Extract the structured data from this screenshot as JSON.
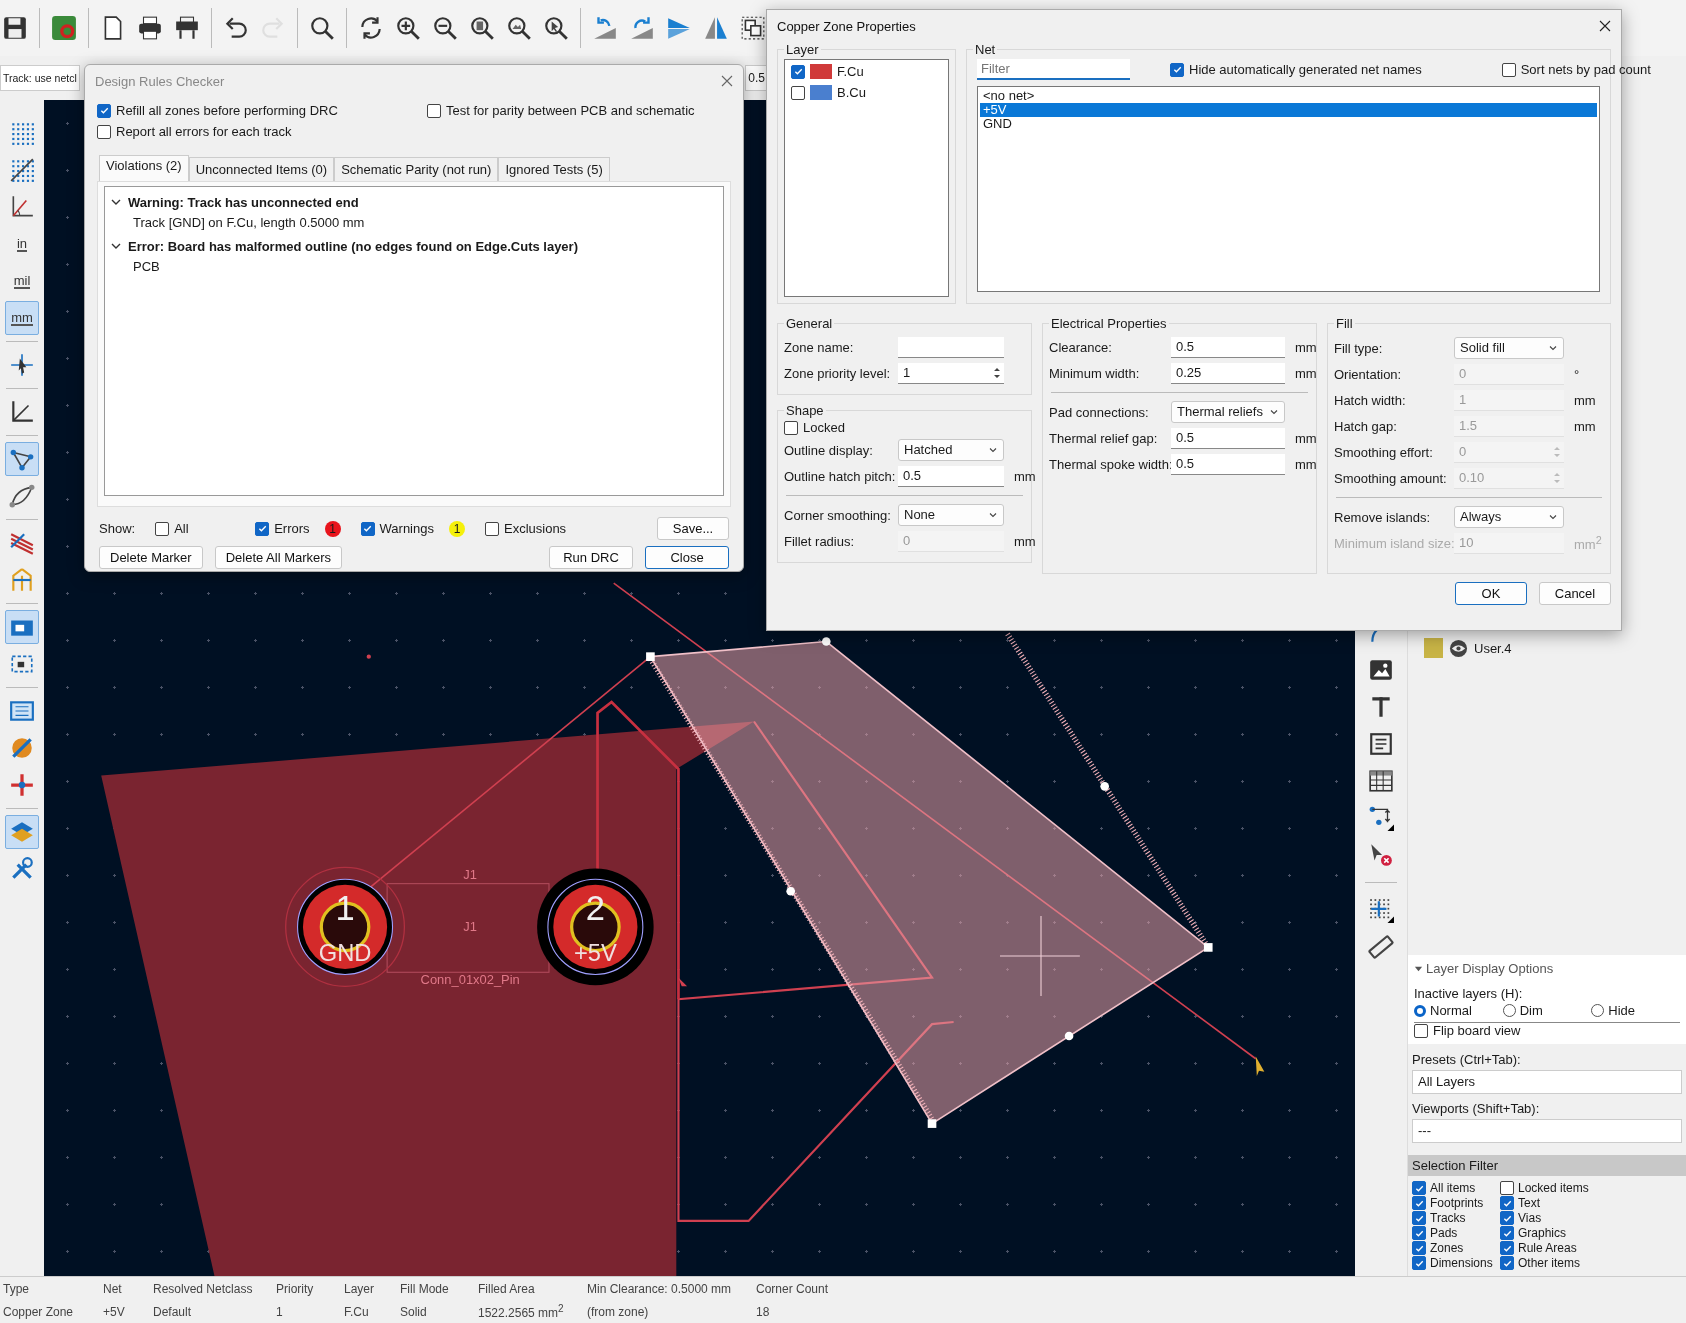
{
  "top_toolbar": [
    {
      "disabled": false
    },
    {
      "disabled": false
    },
    {
      "disabled": false
    },
    {
      "disabled": false
    },
    {
      "disabled": false
    },
    {
      "disabled": false
    },
    {
      "disabled": true
    },
    {
      "disabled": false
    },
    {
      "disabled": false
    },
    {
      "disabled": false
    },
    {
      "disabled": false
    },
    {
      "disabled": false
    },
    {
      "disabled": false
    },
    {
      "disabled": false
    },
    {
      "disabled": false
    },
    {
      "disabled": false
    },
    {
      "disabled": false
    },
    {
      "disabled": false
    },
    {
      "disabled": false
    }
  ],
  "aux_toolbar": {
    "track_selector": "Track: use netcl",
    "width_field": "0.5"
  },
  "left_toolbar": [
    {
      "selected": false
    },
    {
      "selected": false
    },
    {
      "selected": false
    },
    {
      "label": "in",
      "selected": false
    },
    {
      "label": "mil",
      "selected": false
    },
    {
      "label": "mm",
      "selected": true
    },
    {
      "selected": false
    },
    {
      "selected": false
    },
    {
      "selected": true
    },
    {
      "selected": false
    },
    {
      "selected": false
    },
    {
      "selected": false
    },
    {
      "selected": true
    },
    {
      "selected": false
    },
    {
      "selected": false
    },
    {
      "selected": false
    },
    {
      "selected": false
    },
    {
      "selected": true
    },
    {
      "selected": false
    }
  ],
  "pcb": {
    "pads": [
      {
        "number": "1",
        "net": "GND"
      },
      {
        "number": "2",
        "net": "+5V"
      }
    ],
    "reference_labels": [
      "J1",
      "J1"
    ],
    "value_label": "Conn_01x02_Pin"
  },
  "layers_panel": {
    "layers": [
      {
        "name": "User.4",
        "color": "#c8b446",
        "visible": true
      }
    ],
    "display_options": {
      "title": "Layer Display Options",
      "expanded": true,
      "inactive_label": "Inactive layers (H):",
      "radios": [
        {
          "label": "Normal",
          "selected": true
        },
        {
          "label": "Dim",
          "selected": false
        },
        {
          "label": "Hide",
          "selected": false
        }
      ],
      "flip": {
        "label": "Flip board view",
        "checked": false
      }
    },
    "presets_label": "Presets (Ctrl+Tab):",
    "presets_value": "All Layers",
    "viewports_label": "Viewports (Shift+Tab):",
    "viewports_value": "---"
  },
  "selection_filter": {
    "title": "Selection Filter",
    "items": [
      {
        "label": "All items",
        "checked": true
      },
      {
        "label": "Locked items",
        "checked": false
      },
      {
        "label": "Footprints",
        "checked": true
      },
      {
        "label": "Text",
        "checked": true
      },
      {
        "label": "Tracks",
        "checked": true
      },
      {
        "label": "Vias",
        "checked": true
      },
      {
        "label": "Pads",
        "checked": true
      },
      {
        "label": "Graphics",
        "checked": true
      },
      {
        "label": "Zones",
        "checked": true
      },
      {
        "label": "Rule Areas",
        "checked": true
      },
      {
        "label": "Dimensions",
        "checked": true
      },
      {
        "label": "Other items",
        "checked": true
      }
    ]
  },
  "status_bar": [
    {
      "header": "Type",
      "value": "Copper Zone"
    },
    {
      "header": "Net",
      "value": "+5V"
    },
    {
      "header": "Resolved Netclass",
      "value": "Default"
    },
    {
      "header": "Priority",
      "value": "1"
    },
    {
      "header": "Layer",
      "value": "F.Cu"
    },
    {
      "header": "Fill Mode",
      "value": "Solid"
    },
    {
      "header": "Filled Area",
      "value": "1522.2565 mm$^{2}$"
    },
    {
      "header": "Min Clearance: 0.5000 mm",
      "value": "(from zone)"
    },
    {
      "header": "Corner Count",
      "value": "18"
    }
  ],
  "drc": {
    "title": "Design Rules Checker",
    "active": false,
    "options": [
      {
        "label": "Refill all zones before performing DRC",
        "checked": true
      },
      {
        "label": "Test for parity between PCB and schematic",
        "checked": false
      },
      {
        "label": "Report all errors for each track",
        "checked": false
      }
    ],
    "tabs": [
      {
        "label": "Violations (2)",
        "selected": true
      },
      {
        "label": "Unconnected Items (0)",
        "selected": false
      },
      {
        "label": "Schematic Parity (not run)",
        "selected": false
      },
      {
        "label": "Ignored Tests (5)",
        "selected": false
      }
    ],
    "violations": [
      {
        "title": "Warning: Track has unconnected end",
        "expanded": true,
        "children": [
          {
            "text": "Track [GND] on F.Cu, length 0.5000 mm"
          }
        ]
      },
      {
        "title": "Error: Board has malformed outline (no edges found on Edge.Cuts layer)",
        "expanded": true,
        "children": [
          {
            "text": "PCB"
          }
        ]
      }
    ],
    "show_label": "Show:",
    "filters": [
      {
        "label": "All",
        "checked": false
      },
      {
        "label": "Errors",
        "checked": true,
        "count": "1",
        "color": "#e8141c"
      },
      {
        "label": "Warnings",
        "checked": true,
        "count": "1",
        "color": "#f5f00a"
      },
      {
        "label": "Exclusions",
        "checked": false
      }
    ],
    "save_button": "Save...",
    "left_buttons": [
      "Delete Marker",
      "Delete All Markers"
    ],
    "right_buttons": [
      {
        "label": "Run DRC",
        "default": false
      },
      {
        "label": "Close",
        "default": true
      }
    ]
  },
  "zone": {
    "title": "Copper Zone Properties",
    "active": true,
    "layer_label": "Layer",
    "layers": [
      {
        "name": "F.Cu",
        "checked": true,
        "color": "#d03a3a"
      },
      {
        "name": "B.Cu",
        "checked": false,
        "color": "#4a7fcf"
      }
    ],
    "net_label": "Net",
    "filter_placeholder": "Filter",
    "hide_auto": {
      "label": "Hide automatically generated net names",
      "checked": true
    },
    "sort_by_pads": {
      "label": "Sort nets by pad count",
      "checked": false
    },
    "nets": [
      {
        "name": "<no net>",
        "selected": false
      },
      {
        "name": "+5V",
        "selected": true
      },
      {
        "name": "GND",
        "selected": false
      }
    ],
    "general": {
      "title": "General",
      "sections": [
        {
          "fields": [
            {
              "label": "Zone name:",
              "kind": "text",
              "disabled": false
            },
            {
              "label": "Zone priority level:",
              "kind": "spin",
              "value": "1",
              "disabled": false
            }
          ]
        }
      ]
    },
    "shape": {
      "title": "Shape",
      "locked": {
        "label": "Locked",
        "checked": false
      },
      "sections": [
        {
          "fields": [
            {
              "label": "Outline display:",
              "kind": "select",
              "value": "Hatched",
              "disabled": false
            },
            {
              "label": "Outline hatch pitch:",
              "kind": "text",
              "value": "0.5",
              "unit": "mm",
              "disabled": false
            }
          ]
        },
        {
          "fields": [
            {
              "label": "Corner smoothing:",
              "kind": "select",
              "value": "None",
              "disabled": false
            },
            {
              "label": "Fillet radius:",
              "kind": "text",
              "value": "0",
              "unit": "mm",
              "disabled": true
            }
          ]
        }
      ]
    },
    "electrical": {
      "title": "Electrical Properties",
      "sections": [
        {
          "fields": [
            {
              "label": "Clearance:",
              "kind": "text",
              "value": "0.5",
              "unit": "mm",
              "disabled": false
            },
            {
              "label": "Minimum width:",
              "kind": "text",
              "value": "0.25",
              "unit": "mm",
              "disabled": false
            }
          ]
        },
        {
          "fields": [
            {
              "label": "Pad connections:",
              "kind": "select",
              "value": "Thermal reliefs",
              "disabled": false
            },
            {
              "label": "Thermal relief gap:",
              "kind": "text",
              "value": "0.5",
              "unit": "mm",
              "disabled": false
            },
            {
              "label": "Thermal spoke width:",
              "kind": "text",
              "value": "0.5",
              "unit": "mm",
              "disabled": false
            }
          ]
        }
      ]
    },
    "fill": {
      "title": "Fill",
      "sections": [
        {
          "fields": [
            {
              "label": "Fill type:",
              "kind": "select",
              "value": "Solid fill",
              "disabled": false
            },
            {
              "label": "Orientation:",
              "kind": "text",
              "value": "0",
              "unit": "°",
              "disabled": true
            },
            {
              "label": "Hatch width:",
              "kind": "text",
              "value": "1",
              "unit": "mm",
              "disabled": true
            },
            {
              "label": "Hatch gap:",
              "kind": "text",
              "value": "1.5",
              "unit": "mm",
              "disabled": true
            },
            {
              "label": "Smoothing effort:",
              "kind": "spin",
              "value": "0",
              "disabled": true
            },
            {
              "label": "Smoothing amount:",
              "kind": "spin",
              "value": "0.10",
              "disabled": true
            }
          ]
        },
        {
          "fields": [
            {
              "label": "Remove islands:",
              "kind": "select",
              "value": "Always",
              "disabled": false
            },
            {
              "label": "Minimum island size:",
              "kind": "text",
              "value": "10",
              "unit": "mm$^{2}$",
              "disabled": true,
              "label_disabled": true
            }
          ]
        }
      ]
    },
    "buttons": [
      {
        "label": "OK",
        "default": true
      },
      {
        "label": "Cancel",
        "default": false
      }
    ]
  }
}
